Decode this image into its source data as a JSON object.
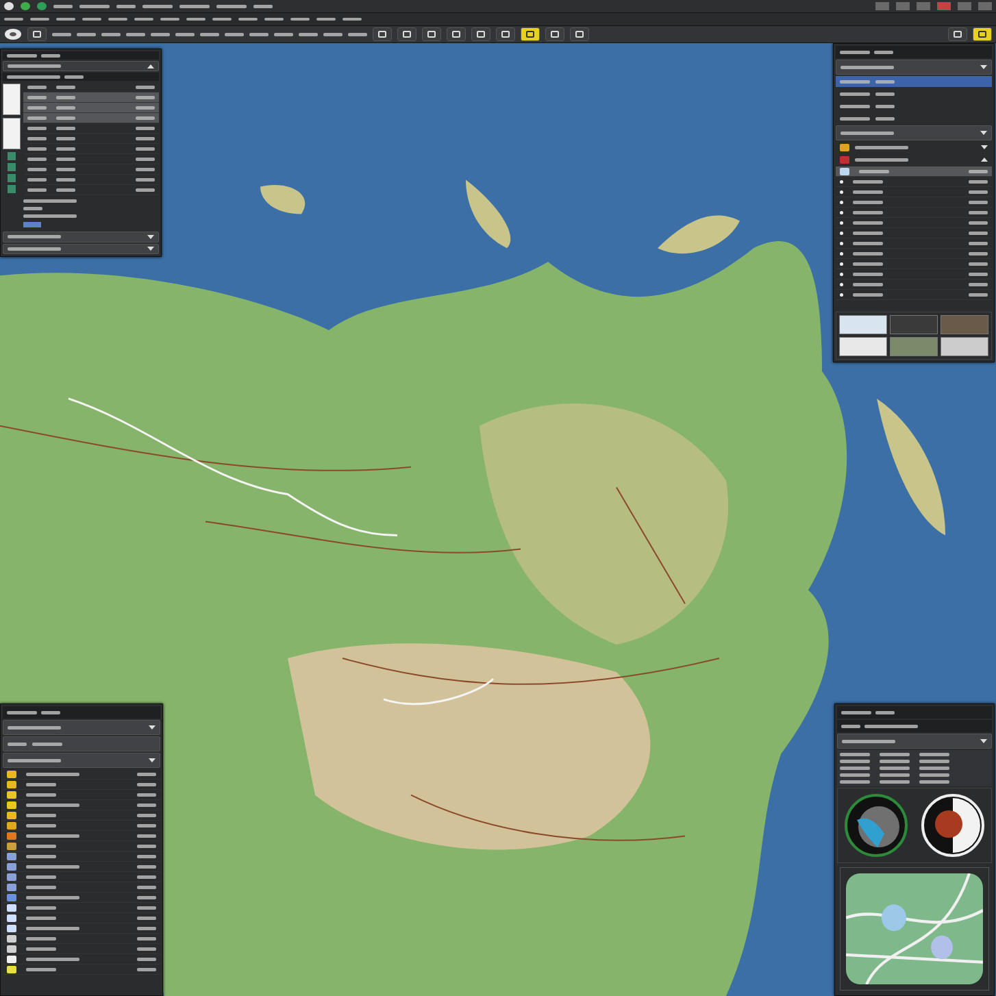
{
  "menu_bar": {
    "icons": [
      {
        "color": "#e0e0e0"
      },
      {
        "color": "#3fae4a"
      },
      {
        "color": "#2f9e5a"
      }
    ],
    "words": [
      {
        "kind": "short"
      },
      {
        "kind": "medium"
      },
      {
        "kind": "short"
      },
      {
        "kind": "medium"
      },
      {
        "kind": "medium"
      },
      {
        "kind": "medium"
      },
      {
        "kind": "short"
      }
    ],
    "window_buttons": [
      {
        "kind": "plain"
      },
      {
        "kind": "plain"
      },
      {
        "kind": "plain"
      },
      {
        "kind": "alert"
      },
      {
        "kind": "plain"
      },
      {
        "kind": "plain"
      }
    ]
  },
  "toolbar_1": {
    "words": [
      {
        "kind": "short"
      },
      {
        "kind": "short"
      },
      {
        "kind": "short"
      },
      {
        "kind": "short"
      },
      {
        "kind": "short"
      },
      {
        "kind": "short"
      },
      {
        "kind": "short"
      },
      {
        "kind": "short"
      },
      {
        "kind": "short"
      },
      {
        "kind": "short"
      },
      {
        "kind": "short"
      },
      {
        "kind": "short"
      },
      {
        "kind": "short"
      },
      {
        "kind": "short"
      }
    ]
  },
  "toolbar_2": {
    "items": [
      {
        "kind": "logo"
      },
      {
        "kind": "tool"
      },
      {
        "kind": "word"
      },
      {
        "kind": "word"
      },
      {
        "kind": "word"
      },
      {
        "kind": "word"
      },
      {
        "kind": "word"
      },
      {
        "kind": "word"
      },
      {
        "kind": "word"
      },
      {
        "kind": "word"
      },
      {
        "kind": "word"
      },
      {
        "kind": "word"
      },
      {
        "kind": "word"
      },
      {
        "kind": "word"
      },
      {
        "kind": "word"
      },
      {
        "kind": "tool"
      },
      {
        "kind": "tool"
      },
      {
        "kind": "tool"
      },
      {
        "kind": "tool"
      },
      {
        "kind": "tool"
      },
      {
        "kind": "tool"
      },
      {
        "kind": "highlight"
      },
      {
        "kind": "tool"
      },
      {
        "kind": "tool"
      }
    ],
    "right": [
      {
        "kind": "tool"
      },
      {
        "kind": "highlight"
      }
    ]
  },
  "top_left_panel": {
    "rows": [
      {
        "kind": "header"
      },
      {
        "kind": "dropdown",
        "expanded": true
      },
      {
        "kind": "table-head"
      },
      {
        "kind": "table",
        "rows": [
          {
            "selected": false
          },
          {
            "selected": true
          },
          {
            "selected": true
          },
          {
            "selected": true
          },
          {
            "selected": false
          },
          {
            "selected": false
          },
          {
            "selected": false
          },
          {
            "selected": false
          },
          {
            "selected": false
          },
          {
            "selected": false
          },
          {
            "selected": false
          }
        ]
      },
      {
        "kind": "notes",
        "lines": [
          {
            "kind": "long"
          },
          {
            "kind": "short"
          },
          {
            "kind": "long"
          }
        ],
        "link": true
      },
      {
        "kind": "dropdown",
        "expanded": false
      },
      {
        "kind": "dropdown",
        "expanded": false
      }
    ]
  },
  "top_right_panel": {
    "rows": [
      {
        "kind": "header"
      },
      {
        "kind": "dropdown",
        "expanded": false
      },
      {
        "kind": "item",
        "selected": true
      },
      {
        "kind": "item",
        "selected": false
      },
      {
        "kind": "item",
        "selected": false
      },
      {
        "kind": "item",
        "selected": false
      },
      {
        "kind": "dropdown",
        "expanded": false
      },
      {
        "kind": "group",
        "expanded": false,
        "color": "#e0a020"
      },
      {
        "kind": "group",
        "expanded": true,
        "color": "#c03030"
      },
      {
        "kind": "layer-list",
        "rows": [
          {
            "selected": true
          },
          {
            "selected": false
          },
          {
            "selected": false
          },
          {
            "selected": false
          },
          {
            "selected": false
          },
          {
            "selected": false
          },
          {
            "selected": false
          },
          {
            "selected": false
          },
          {
            "selected": false
          },
          {
            "selected": false
          },
          {
            "selected": false
          },
          {
            "selected": false
          },
          {
            "selected": false
          }
        ]
      },
      {
        "kind": "thumbs"
      }
    ]
  },
  "bottom_left_panel": {
    "rows": [
      {
        "kind": "header"
      },
      {
        "kind": "dropdown",
        "expanded": false
      },
      {
        "kind": "search"
      },
      {
        "kind": "dropdown",
        "expanded": false
      },
      {
        "kind": "icon-list",
        "rows": [
          {
            "color": "#e8b820"
          },
          {
            "color": "#e8b820"
          },
          {
            "color": "#e8c820"
          },
          {
            "color": "#e8c820"
          },
          {
            "color": "#e8b820"
          },
          {
            "color": "#e0a820"
          },
          {
            "color": "#e07820"
          },
          {
            "color": "#c8a040"
          },
          {
            "color": "#8aa0d8"
          },
          {
            "color": "#8aa0d8"
          },
          {
            "color": "#8aa0d8"
          },
          {
            "color": "#8aa0d8"
          },
          {
            "color": "#6a90e0"
          },
          {
            "color": "#cfe0ff"
          },
          {
            "color": "#cfe0ff"
          },
          {
            "color": "#cfe0ff"
          },
          {
            "color": "#d0d0d0"
          },
          {
            "color": "#d0d0d0"
          },
          {
            "color": "#f0f0f0"
          },
          {
            "color": "#e8e040"
          }
        ]
      }
    ]
  },
  "bottom_right_panel": {
    "rows": [
      {
        "kind": "header"
      },
      {
        "kind": "subheader"
      },
      {
        "kind": "dropdown",
        "expanded": false
      },
      {
        "kind": "grid"
      },
      {
        "kind": "gauges"
      },
      {
        "kind": "minimap"
      }
    ]
  }
}
